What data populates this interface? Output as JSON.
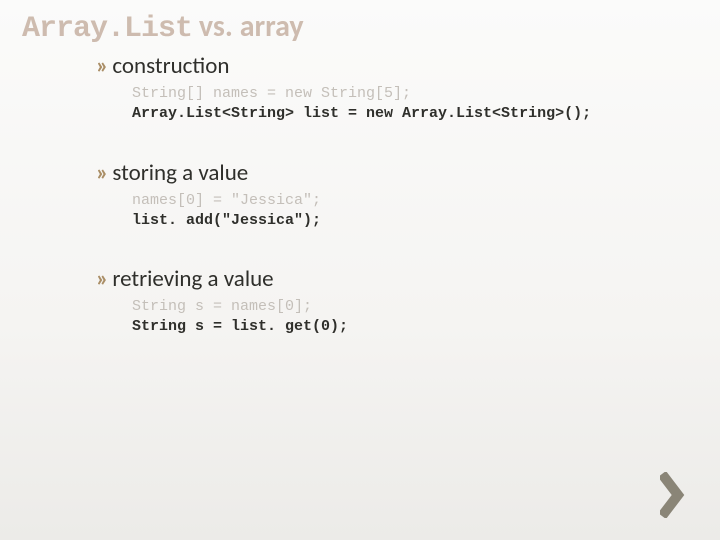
{
  "title": {
    "mono": "Array.List",
    "vs": " vs. ",
    "plain": "array"
  },
  "sections": [
    {
      "heading": "construction",
      "dim": "String[] names = new String[5];",
      "bold": "Array.List<String> list = new Array.List<String>();"
    },
    {
      "heading": "storing a value",
      "dim": "names[0] = \"Jessica\";",
      "bold": "list. add(\"Jessica\");"
    },
    {
      "heading": "retrieving a value",
      "dim": "String s = names[0];",
      "bold": "String s = list. get(0);"
    }
  ]
}
